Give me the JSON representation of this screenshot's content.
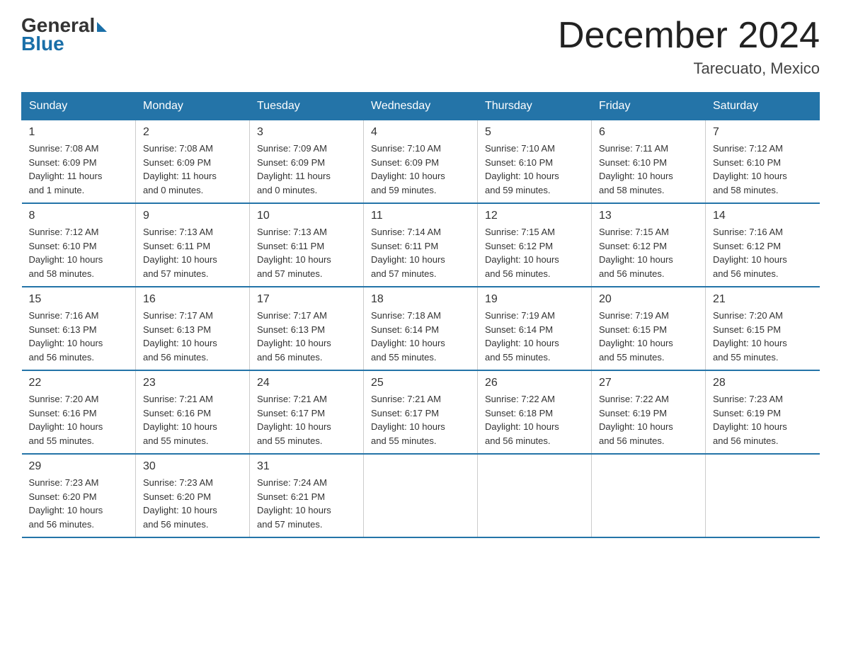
{
  "logo": {
    "general": "General",
    "blue": "Blue"
  },
  "title": "December 2024",
  "location": "Tarecuato, Mexico",
  "days_header": [
    "Sunday",
    "Monday",
    "Tuesday",
    "Wednesday",
    "Thursday",
    "Friday",
    "Saturday"
  ],
  "weeks": [
    [
      {
        "day": "1",
        "info": "Sunrise: 7:08 AM\nSunset: 6:09 PM\nDaylight: 11 hours\nand 1 minute."
      },
      {
        "day": "2",
        "info": "Sunrise: 7:08 AM\nSunset: 6:09 PM\nDaylight: 11 hours\nand 0 minutes."
      },
      {
        "day": "3",
        "info": "Sunrise: 7:09 AM\nSunset: 6:09 PM\nDaylight: 11 hours\nand 0 minutes."
      },
      {
        "day": "4",
        "info": "Sunrise: 7:10 AM\nSunset: 6:09 PM\nDaylight: 10 hours\nand 59 minutes."
      },
      {
        "day": "5",
        "info": "Sunrise: 7:10 AM\nSunset: 6:10 PM\nDaylight: 10 hours\nand 59 minutes."
      },
      {
        "day": "6",
        "info": "Sunrise: 7:11 AM\nSunset: 6:10 PM\nDaylight: 10 hours\nand 58 minutes."
      },
      {
        "day": "7",
        "info": "Sunrise: 7:12 AM\nSunset: 6:10 PM\nDaylight: 10 hours\nand 58 minutes."
      }
    ],
    [
      {
        "day": "8",
        "info": "Sunrise: 7:12 AM\nSunset: 6:10 PM\nDaylight: 10 hours\nand 58 minutes."
      },
      {
        "day": "9",
        "info": "Sunrise: 7:13 AM\nSunset: 6:11 PM\nDaylight: 10 hours\nand 57 minutes."
      },
      {
        "day": "10",
        "info": "Sunrise: 7:13 AM\nSunset: 6:11 PM\nDaylight: 10 hours\nand 57 minutes."
      },
      {
        "day": "11",
        "info": "Sunrise: 7:14 AM\nSunset: 6:11 PM\nDaylight: 10 hours\nand 57 minutes."
      },
      {
        "day": "12",
        "info": "Sunrise: 7:15 AM\nSunset: 6:12 PM\nDaylight: 10 hours\nand 56 minutes."
      },
      {
        "day": "13",
        "info": "Sunrise: 7:15 AM\nSunset: 6:12 PM\nDaylight: 10 hours\nand 56 minutes."
      },
      {
        "day": "14",
        "info": "Sunrise: 7:16 AM\nSunset: 6:12 PM\nDaylight: 10 hours\nand 56 minutes."
      }
    ],
    [
      {
        "day": "15",
        "info": "Sunrise: 7:16 AM\nSunset: 6:13 PM\nDaylight: 10 hours\nand 56 minutes."
      },
      {
        "day": "16",
        "info": "Sunrise: 7:17 AM\nSunset: 6:13 PM\nDaylight: 10 hours\nand 56 minutes."
      },
      {
        "day": "17",
        "info": "Sunrise: 7:17 AM\nSunset: 6:13 PM\nDaylight: 10 hours\nand 56 minutes."
      },
      {
        "day": "18",
        "info": "Sunrise: 7:18 AM\nSunset: 6:14 PM\nDaylight: 10 hours\nand 55 minutes."
      },
      {
        "day": "19",
        "info": "Sunrise: 7:19 AM\nSunset: 6:14 PM\nDaylight: 10 hours\nand 55 minutes."
      },
      {
        "day": "20",
        "info": "Sunrise: 7:19 AM\nSunset: 6:15 PM\nDaylight: 10 hours\nand 55 minutes."
      },
      {
        "day": "21",
        "info": "Sunrise: 7:20 AM\nSunset: 6:15 PM\nDaylight: 10 hours\nand 55 minutes."
      }
    ],
    [
      {
        "day": "22",
        "info": "Sunrise: 7:20 AM\nSunset: 6:16 PM\nDaylight: 10 hours\nand 55 minutes."
      },
      {
        "day": "23",
        "info": "Sunrise: 7:21 AM\nSunset: 6:16 PM\nDaylight: 10 hours\nand 55 minutes."
      },
      {
        "day": "24",
        "info": "Sunrise: 7:21 AM\nSunset: 6:17 PM\nDaylight: 10 hours\nand 55 minutes."
      },
      {
        "day": "25",
        "info": "Sunrise: 7:21 AM\nSunset: 6:17 PM\nDaylight: 10 hours\nand 55 minutes."
      },
      {
        "day": "26",
        "info": "Sunrise: 7:22 AM\nSunset: 6:18 PM\nDaylight: 10 hours\nand 56 minutes."
      },
      {
        "day": "27",
        "info": "Sunrise: 7:22 AM\nSunset: 6:19 PM\nDaylight: 10 hours\nand 56 minutes."
      },
      {
        "day": "28",
        "info": "Sunrise: 7:23 AM\nSunset: 6:19 PM\nDaylight: 10 hours\nand 56 minutes."
      }
    ],
    [
      {
        "day": "29",
        "info": "Sunrise: 7:23 AM\nSunset: 6:20 PM\nDaylight: 10 hours\nand 56 minutes."
      },
      {
        "day": "30",
        "info": "Sunrise: 7:23 AM\nSunset: 6:20 PM\nDaylight: 10 hours\nand 56 minutes."
      },
      {
        "day": "31",
        "info": "Sunrise: 7:24 AM\nSunset: 6:21 PM\nDaylight: 10 hours\nand 57 minutes."
      },
      {
        "day": "",
        "info": ""
      },
      {
        "day": "",
        "info": ""
      },
      {
        "day": "",
        "info": ""
      },
      {
        "day": "",
        "info": ""
      }
    ]
  ]
}
